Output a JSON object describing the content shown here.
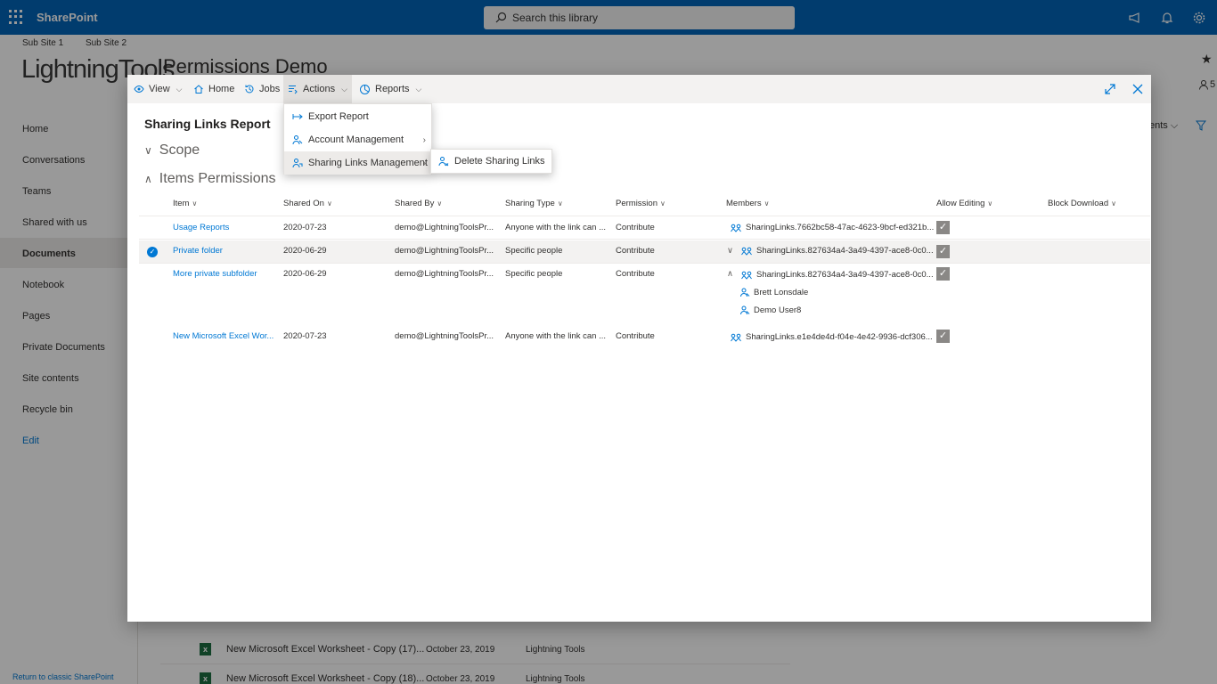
{
  "suitebar": {
    "brand": "SharePoint",
    "search_placeholder": "Search this library"
  },
  "site": {
    "subsites": [
      "Sub Site 1",
      "Sub Site 2"
    ],
    "logo_text": "LightningTools",
    "title": "Permissions Demo"
  },
  "leftnav": {
    "items": [
      "Home",
      "Conversations",
      "Teams",
      "Shared with us",
      "Documents",
      "Notebook",
      "Pages",
      "Private Documents",
      "Site contents",
      "Recycle bin",
      "Edit"
    ],
    "active": "Documents",
    "return_link": "Return to classic SharePoint"
  },
  "background_rows": [
    {
      "name": "New Microsoft Excel Worksheet - Copy (17)...",
      "date": "October 23, 2019",
      "modified_by": "Lightning Tools"
    },
    {
      "name": "New Microsoft Excel Worksheet - Copy (18)...",
      "date": "October 23, 2019",
      "modified_by": "Lightning Tools"
    }
  ],
  "background_right": {
    "text": "ents"
  },
  "toolbar": {
    "view": "View",
    "home": "Home",
    "jobs": "Jobs",
    "actions": "Actions",
    "reports": "Reports"
  },
  "actions_menu": {
    "items": [
      "Export Report",
      "Account Management",
      "Sharing Links Management"
    ]
  },
  "submenu": {
    "items": [
      "Delete Sharing Links"
    ]
  },
  "report": {
    "title": "Sharing Links Report",
    "scope_label": "Scope",
    "items_permissions_label": "Items Permissions",
    "columns": [
      "Item",
      "Shared On",
      "Shared By",
      "Sharing Type",
      "Permission",
      "Members",
      "Allow Editing",
      "Block Download"
    ],
    "rows": [
      {
        "item": "Usage Reports",
        "shared_on": "2020-07-23",
        "shared_by": "demo@LightningToolsPr...",
        "sharing_type": "Anyone with the link can ...",
        "permission": "Contribute",
        "members": "SharingLinks.7662bc58-47ac-4623-9bcf-ed321b...",
        "allow_editing": true
      },
      {
        "item": "Private folder",
        "shared_on": "2020-06-29",
        "shared_by": "demo@LightningToolsPr...",
        "sharing_type": "Specific people",
        "permission": "Contribute",
        "members": "SharingLinks.827634a4-3a49-4397-ace8-0c0...",
        "allow_editing": true
      },
      {
        "item": "More private subfolder",
        "shared_on": "2020-06-29",
        "shared_by": "demo@LightningToolsPr...",
        "sharing_type": "Specific people",
        "permission": "Contribute",
        "members": "SharingLinks.827634a4-3a49-4397-ace8-0c0...",
        "sub_members": [
          "Brett Lonsdale",
          "Demo User8"
        ],
        "allow_editing": true
      },
      {
        "item": "New Microsoft Excel Wor...",
        "shared_on": "2020-07-23",
        "shared_by": "demo@LightningToolsPr...",
        "sharing_type": "Anyone with the link can ...",
        "permission": "Contribute",
        "members": "SharingLinks.e1e4de4d-f04e-4e42-9936-dcf306...",
        "allow_editing": true
      }
    ]
  }
}
